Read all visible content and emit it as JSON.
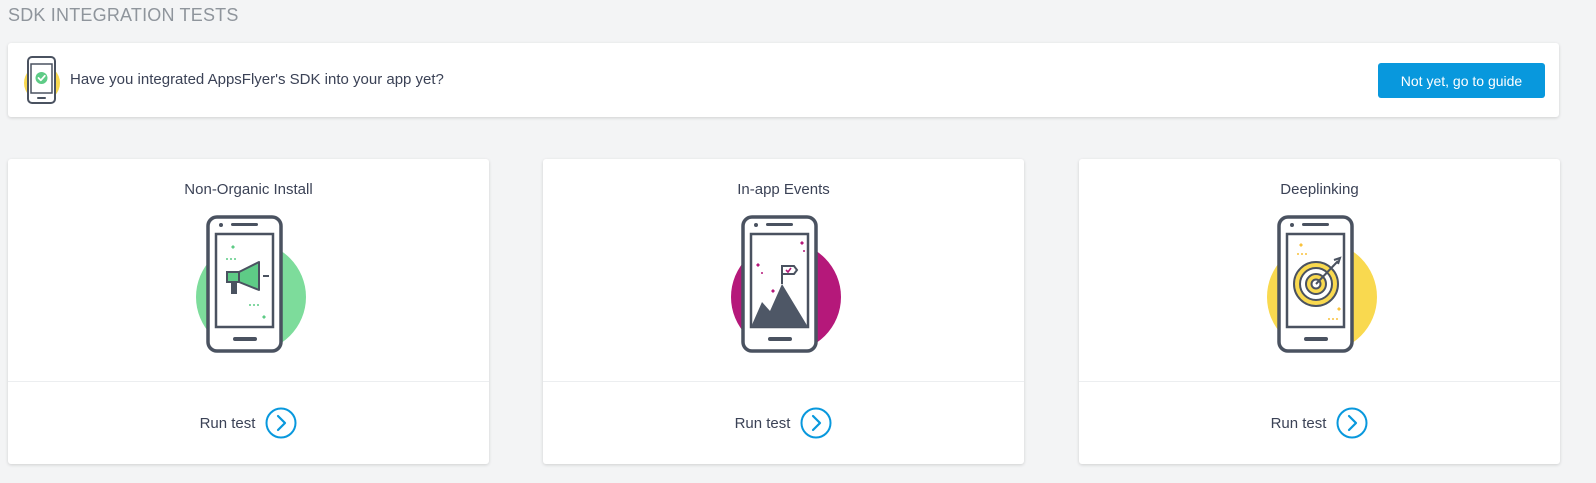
{
  "page": {
    "title": "SDK INTEGRATION TESTS"
  },
  "banner": {
    "icon": "phone-check-icon",
    "text": "Have you integrated AppsFlyer's SDK into your app yet?",
    "button_label": "Not yet, go to guide"
  },
  "cards": [
    {
      "title": "Non-Organic Install",
      "illustration": "megaphone-phone-icon",
      "accent_color": "#7ddc9b",
      "action_label": "Run test",
      "action_icon": "chevron-right-circle-icon"
    },
    {
      "title": "In-app Events",
      "illustration": "mountain-flag-phone-icon",
      "accent_color": "#b5187a",
      "action_label": "Run test",
      "action_icon": "chevron-right-circle-icon"
    },
    {
      "title": "Deeplinking",
      "illustration": "target-phone-icon",
      "accent_color": "#f9d94f",
      "action_label": "Run test",
      "action_icon": "chevron-right-circle-icon"
    }
  ],
  "colors": {
    "primary": "#0898dd",
    "text": "#3b4256",
    "muted": "#8f959c",
    "icon_stroke": "#4a5260"
  }
}
